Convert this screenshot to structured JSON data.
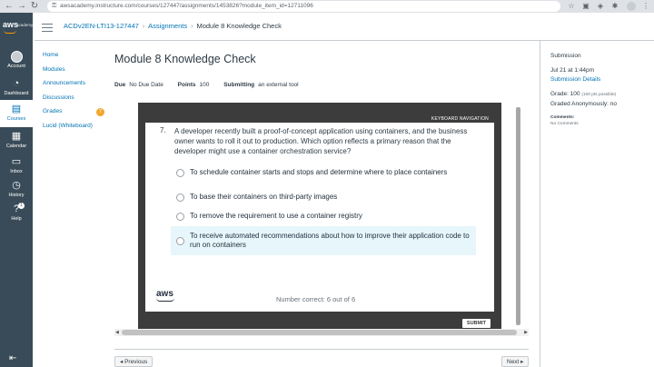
{
  "browser": {
    "url": "awsacademy.instructure.com/courses/127447/assignments/1453826?module_item_id=12711096"
  },
  "global_nav": {
    "logo_text": "aws",
    "logo_sub": "academy",
    "items": [
      {
        "label": "Account"
      },
      {
        "label": "Dashboard"
      },
      {
        "label": "Courses"
      },
      {
        "label": "Calendar"
      },
      {
        "label": "Inbox"
      },
      {
        "label": "History"
      },
      {
        "label": "Help",
        "badge": "1"
      }
    ]
  },
  "breadcrumbs": {
    "course": "ACDv2EN-LTI13-127447",
    "section": "Assignments",
    "current": "Module 8 Knowledge Check"
  },
  "course_nav": {
    "items": [
      {
        "label": "Home"
      },
      {
        "label": "Modules"
      },
      {
        "label": "Announcements"
      },
      {
        "label": "Discussions"
      },
      {
        "label": "Grades",
        "badge": "7"
      },
      {
        "label": "Lucid (Whiteboard)"
      }
    ]
  },
  "assignment": {
    "title": "Module 8 Knowledge Check",
    "due_label": "Due",
    "due_value": "No Due Date",
    "points_label": "Points",
    "points_value": "100",
    "submitting_label": "Submitting",
    "submitting_value": "an external tool"
  },
  "quiz": {
    "keyboard_nav": "KEYBOARD NAVIGATION",
    "question_number": "7.",
    "question": "A developer recently built a proof-of-concept application using containers, and the business owner wants to roll it out to production. Which option reflects a primary reason that the developer might use a container orchestration service?",
    "options": [
      {
        "text": "To schedule container starts and stops and determine where to place containers",
        "selected": false
      },
      {
        "text": "To base their containers on third-party images",
        "selected": false
      },
      {
        "text": "To remove the requirement to use a container registry",
        "selected": false
      },
      {
        "text": "To receive automated recommendations about how to improve their application code to run on containers",
        "selected": true
      }
    ],
    "brand": "aws",
    "number_correct": "Number correct: 6 out of 6",
    "submit_label": "SUBMIT"
  },
  "pager": {
    "previous": "◂ Previous",
    "next": "Next ▸"
  },
  "sidebar": {
    "heading": "Submission",
    "date": "Jul 21 at 1:44pm",
    "details_link": "Submission Details",
    "grade_label": "Grade: 100",
    "grade_note": "(100 pts possible)",
    "graded_anon": "Graded Anonymously: no",
    "comments_heading": "Comments:",
    "comments_value": "No Comments"
  },
  "colors": {
    "link": "#0374b5",
    "global_nav_bg": "#394b58",
    "quiz_frame": "#3c3c3c",
    "selected_option_bg": "#e6f6fb",
    "badge": "#f2a72b"
  }
}
